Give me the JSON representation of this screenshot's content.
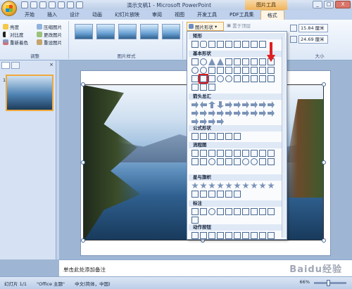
{
  "window": {
    "title": "演示文稿1 - Microsoft PowerPoint",
    "context_tab_group": "图片工具",
    "controls": [
      "_",
      "□",
      "X"
    ]
  },
  "tabs": [
    {
      "label": "开始"
    },
    {
      "label": "插入"
    },
    {
      "label": "设计"
    },
    {
      "label": "动画"
    },
    {
      "label": "幻灯片放映"
    },
    {
      "label": "审阅"
    },
    {
      "label": "视图"
    },
    {
      "label": "开发工具"
    },
    {
      "label": "PDF工具集"
    },
    {
      "label": "格式",
      "active": true
    }
  ],
  "ribbon": {
    "adjust": {
      "label": "调整",
      "buttons": [
        "亮度",
        "对比度",
        "重新着色",
        "压缩图片",
        "更改图片",
        "重设图片"
      ]
    },
    "picture_styles": {
      "label": "图片样式"
    },
    "shape_button": "图片形状",
    "bring_front": "置于顶层",
    "size": {
      "label": "大小",
      "height": "15.84 厘米",
      "width": "24.69 厘米"
    }
  },
  "shape_menu": {
    "sections": [
      "矩形",
      "基本形状",
      "箭头总汇",
      "公式形状",
      "流程图",
      "星与旗帜",
      "标注",
      "动作按钮"
    ]
  },
  "left_panel": {
    "slide_number": "1"
  },
  "notes": {
    "placeholder": "单击此处添加备注"
  },
  "status": {
    "slide": "幻灯片 1/1",
    "theme": "\"Office 主题\"",
    "language": "中文(简体，中国)",
    "zoom": "66%"
  },
  "watermark": "Baidu经验"
}
